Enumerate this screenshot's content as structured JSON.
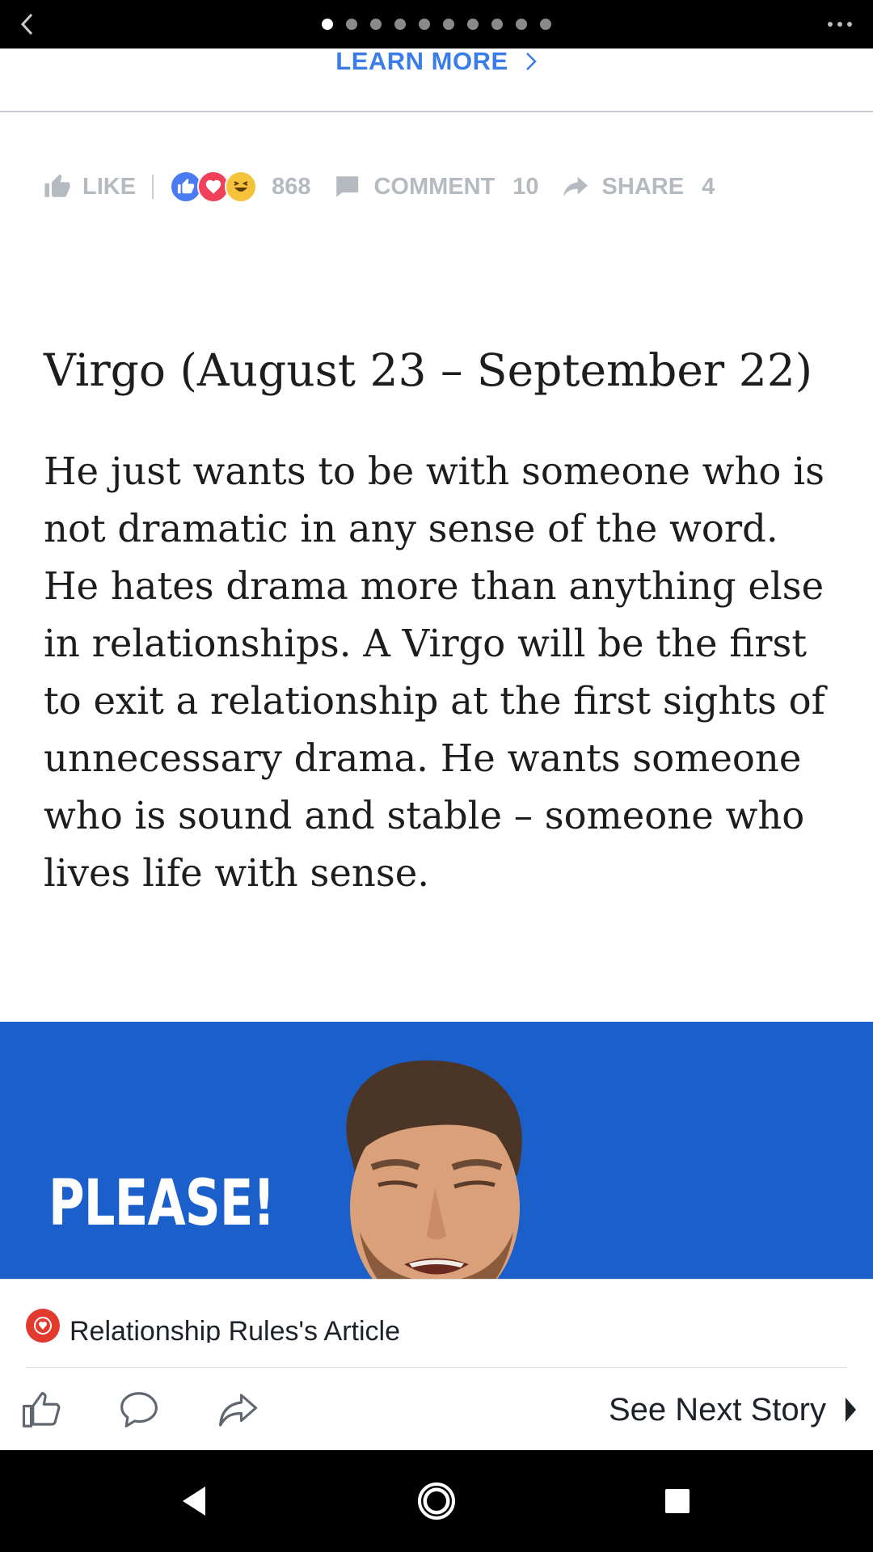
{
  "carousel": {
    "pages": 10,
    "active_index": 0
  },
  "icons": {
    "back": "chevron-left-icon",
    "more": "more-horizontal-icon",
    "learn_more_chevron": "chevron-right-icon"
  },
  "ad": {
    "learn_more_label": "LEARN MORE",
    "accent_color": "#3b7de8"
  },
  "reactions": {
    "like_label": "LIKE",
    "reaction_count": "868",
    "comment_label": "COMMENT",
    "comment_count": "10",
    "share_label": "SHARE",
    "share_count": "4",
    "reaction_types": [
      "like",
      "love",
      "haha"
    ]
  },
  "article": {
    "headline": "Virgo (August 23 – September 22)",
    "body": "He just wants to be with someone who is not dramatic in any sense of the word. He hates drama more than anything else in relationships. A Virgo will be the first to exit a relationship at the first sights of unnecessary drama. He wants someone who is sound and stable – someone who lives life with sense."
  },
  "banner": {
    "text": "PLEASE!",
    "background": "#1b5fcb"
  },
  "footer": {
    "source_label": "Relationship Rules's Article",
    "next_story_label": "See Next Story"
  },
  "nav": {
    "buttons": [
      "back-nav-icon",
      "home-nav-icon",
      "recents-nav-icon"
    ]
  }
}
